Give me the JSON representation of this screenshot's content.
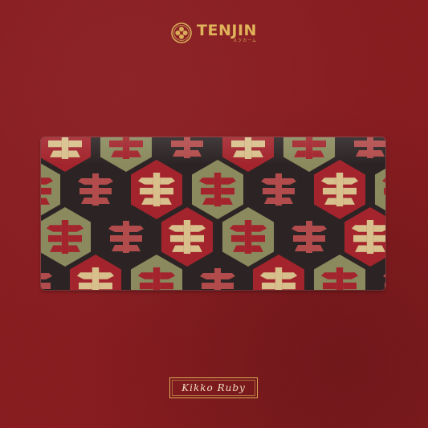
{
  "brand": {
    "name": "TENJIN",
    "sub": "スクカーム",
    "logo_icon": "tenjin-flower-crest-icon"
  },
  "product": {
    "name": "Kikko Ruby",
    "pattern": "kikko-hexagon-motif"
  },
  "colors": {
    "background": "#8f1e22",
    "gold": "#d9ac58",
    "mat_base": "#2c2424",
    "red": "#a3242c",
    "olive": "#8a8a5e",
    "tan": "#d8c08c",
    "rose": "#b24b4b"
  }
}
